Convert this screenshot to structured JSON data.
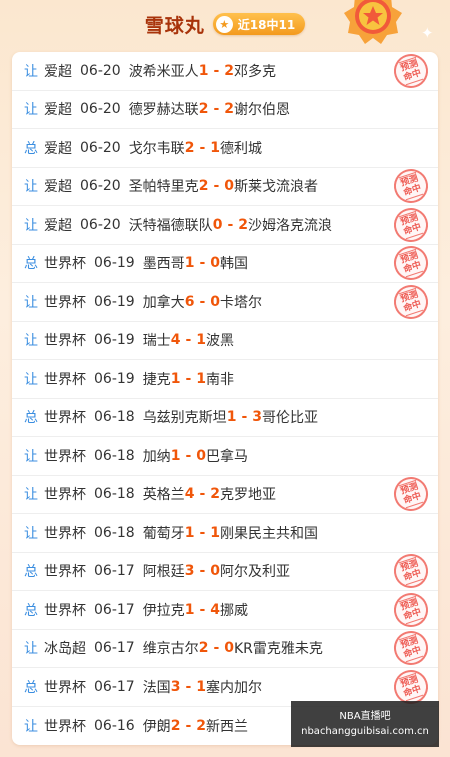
{
  "header": {
    "title": "雪球丸",
    "record_badge": "近18中11"
  },
  "matches": [
    {
      "tag": "让",
      "league": "爱超",
      "date": "06-20",
      "home": "波希米亚人",
      "home_score": "1",
      "sep": "-",
      "away_score": "2",
      "away": "邓多克",
      "hit": true
    },
    {
      "tag": "让",
      "league": "爱超",
      "date": "06-20",
      "home": "德罗赫达联",
      "home_score": "2",
      "sep": "-",
      "away_score": "2",
      "away": "谢尔伯恩",
      "hit": false
    },
    {
      "tag": "总",
      "league": "爱超",
      "date": "06-20",
      "home": "戈尔韦联",
      "home_score": "2",
      "sep": "-",
      "away_score": "1",
      "away": "德利城",
      "hit": false
    },
    {
      "tag": "让",
      "league": "爱超",
      "date": "06-20",
      "home": "圣帕特里克",
      "home_score": "2",
      "sep": "-",
      "away_score": "0",
      "away": "斯莱戈流浪者",
      "hit": true
    },
    {
      "tag": "让",
      "league": "爱超",
      "date": "06-20",
      "home": "沃特福德联队",
      "home_score": "0",
      "sep": "-",
      "away_score": "2",
      "away": "沙姆洛克流浪",
      "hit": true
    },
    {
      "tag": "总",
      "league": "世界杯",
      "date": "06-19",
      "home": "墨西哥",
      "home_score": "1",
      "sep": "-",
      "away_score": "0",
      "away": "韩国",
      "hit": true
    },
    {
      "tag": "让",
      "league": "世界杯",
      "date": "06-19",
      "home": "加拿大",
      "home_score": "6",
      "sep": "-",
      "away_score": "0",
      "away": "卡塔尔",
      "hit": true
    },
    {
      "tag": "让",
      "league": "世界杯",
      "date": "06-19",
      "home": "瑞士",
      "home_score": "4",
      "sep": "-",
      "away_score": "1",
      "away": "波黑",
      "hit": false
    },
    {
      "tag": "让",
      "league": "世界杯",
      "date": "06-19",
      "home": "捷克",
      "home_score": "1",
      "sep": "-",
      "away_score": "1",
      "away": "南非",
      "hit": false
    },
    {
      "tag": "总",
      "league": "世界杯",
      "date": "06-18",
      "home": "乌兹别克斯坦",
      "home_score": "1",
      "sep": "-",
      "away_score": "3",
      "away": "哥伦比亚",
      "hit": false
    },
    {
      "tag": "让",
      "league": "世界杯",
      "date": "06-18",
      "home": "加纳",
      "home_score": "1",
      "sep": "-",
      "away_score": "0",
      "away": "巴拿马",
      "hit": false
    },
    {
      "tag": "让",
      "league": "世界杯",
      "date": "06-18",
      "home": "英格兰",
      "home_score": "4",
      "sep": "-",
      "away_score": "2",
      "away": "克罗地亚",
      "hit": true
    },
    {
      "tag": "让",
      "league": "世界杯",
      "date": "06-18",
      "home": "葡萄牙",
      "home_score": "1",
      "sep": "-",
      "away_score": "1",
      "away": "刚果民主共和国",
      "hit": false
    },
    {
      "tag": "总",
      "league": "世界杯",
      "date": "06-17",
      "home": "阿根廷",
      "home_score": "3",
      "sep": "-",
      "away_score": "0",
      "away": "阿尔及利亚",
      "hit": true
    },
    {
      "tag": "总",
      "league": "世界杯",
      "date": "06-17",
      "home": "伊拉克",
      "home_score": "1",
      "sep": "-",
      "away_score": "4",
      "away": "挪威",
      "hit": true
    },
    {
      "tag": "让",
      "league": "冰岛超",
      "date": "06-17",
      "home": "维京古尔",
      "home_score": "2",
      "sep": "-",
      "away_score": "0",
      "away": "KR雷克雅未克",
      "hit": true
    },
    {
      "tag": "总",
      "league": "世界杯",
      "date": "06-17",
      "home": "法国",
      "home_score": "3",
      "sep": "-",
      "away_score": "1",
      "away": "塞内加尔",
      "hit": true
    },
    {
      "tag": "让",
      "league": "世界杯",
      "date": "06-16",
      "home": "伊朗",
      "home_score": "2",
      "sep": "-",
      "away_score": "2",
      "away": "新西兰",
      "hit": false
    }
  ],
  "stamp": {
    "line1": "预测",
    "line2": "命中"
  },
  "watermark": {
    "line1": "NBA直播吧",
    "line2": "nbachangguibisai.com.cn"
  },
  "colors": {
    "tag": "#3b8ee0",
    "score": "#f0560a",
    "title": "#a8330a",
    "stamp": "#ee5d55"
  }
}
